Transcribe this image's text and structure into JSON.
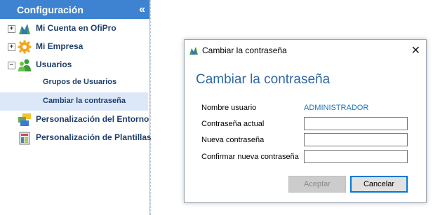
{
  "sidebar": {
    "title": "Configuración",
    "collapse_symbol": "«",
    "items": [
      {
        "label": "Mi Cuenta en OfiPro",
        "toggle": "+",
        "icon": "chart-icon"
      },
      {
        "label": "Mi Empresa",
        "toggle": "+",
        "icon": "gear-icon"
      },
      {
        "label": "Usuarios",
        "toggle": "−",
        "icon": "users-icon"
      },
      {
        "label": "Grupos de Usuarios"
      },
      {
        "label": "Cambiar la contraseña",
        "selected": true
      },
      {
        "label": "Personalización del Entorno",
        "icon": "layout-icon"
      },
      {
        "label": "Personalización de Plantillas",
        "icon": "template-icon"
      }
    ]
  },
  "dialog": {
    "window_title": "Cambiar la contraseña",
    "close_symbol": "✕",
    "heading": "Cambiar la contraseña",
    "fields": {
      "username_label": "Nombre usuario",
      "username_value": "ADMINISTRADOR",
      "current_label": "Contraseña actual",
      "current_value": "",
      "new_label": "Nueva contraseña",
      "new_value": "",
      "confirm_label": "Confirmar nueva contraseña",
      "confirm_value": ""
    },
    "buttons": {
      "accept": "Aceptar",
      "cancel": "Cancelar"
    }
  },
  "colors": {
    "header_bg": "#3d83d1",
    "selected_bg": "#dce8f8",
    "heading": "#2f69a5",
    "username_value": "#1b74b8"
  }
}
